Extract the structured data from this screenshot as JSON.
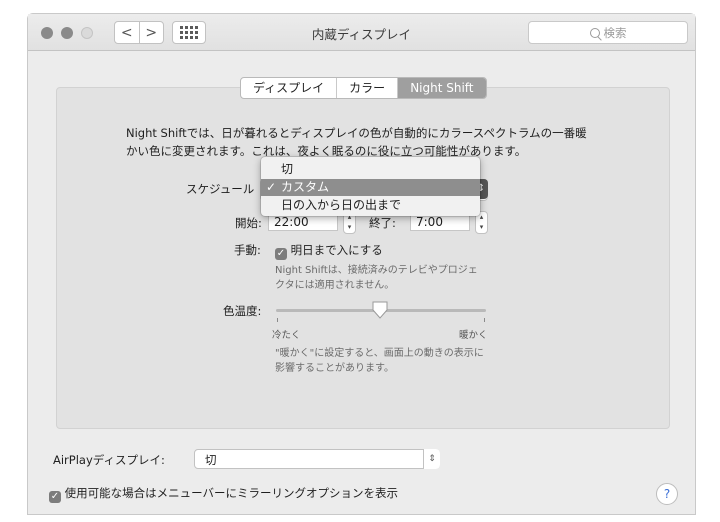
{
  "window": {
    "title": "内蔵ディスプレイ",
    "search_placeholder": "検索",
    "nav_back": "<",
    "nav_forward": ">"
  },
  "tabs": [
    {
      "label": "ディスプレイ",
      "selected": false
    },
    {
      "label": "カラー",
      "selected": false
    },
    {
      "label": "Night Shift",
      "selected": true
    }
  ],
  "night_shift": {
    "description_line1": "Night Shiftでは、日が暮れるとディスプレイの色が自動的にカラースペクトラムの一番暖",
    "description_line2": "かい色に変更されます。これは、夜よく眠るのに役に立つ可能性があります。",
    "schedule_label": "スケジュール",
    "schedule_options": [
      "切",
      "カスタム",
      "日の入から日の出まで"
    ],
    "schedule_selected": "カスタム",
    "start_label": "開始:",
    "start_time": "22:00",
    "end_label": "終了:",
    "end_time": "7:00",
    "manual_label": "手動:",
    "manual_checkbox_label": "明日まで入にする",
    "manual_checked": true,
    "manual_note_line1": "Night Shiftは、接続済みのテレビやプロジェ",
    "manual_note_line2": "クタには適用されません。",
    "temperature_label": "色温度:",
    "temperature_left": "冷たく",
    "temperature_right": "暖かく",
    "temperature_level": 0.5,
    "temperature_note_line1": "\"暖かく\"に設定すると、画面上の動きの表示に",
    "temperature_note_line2": "影響することがあります。"
  },
  "airplay": {
    "label": "AirPlayディスプレイ:",
    "value": "切"
  },
  "mirroring": {
    "label": "使用可能な場合はメニューバーにミラーリングオプションを表示",
    "checked": true
  },
  "help": "?",
  "colors": {
    "selected_tab": "#9f9f9f",
    "menu_highlight": "#8e8e8e",
    "checkbox": "#7d7d7d"
  }
}
